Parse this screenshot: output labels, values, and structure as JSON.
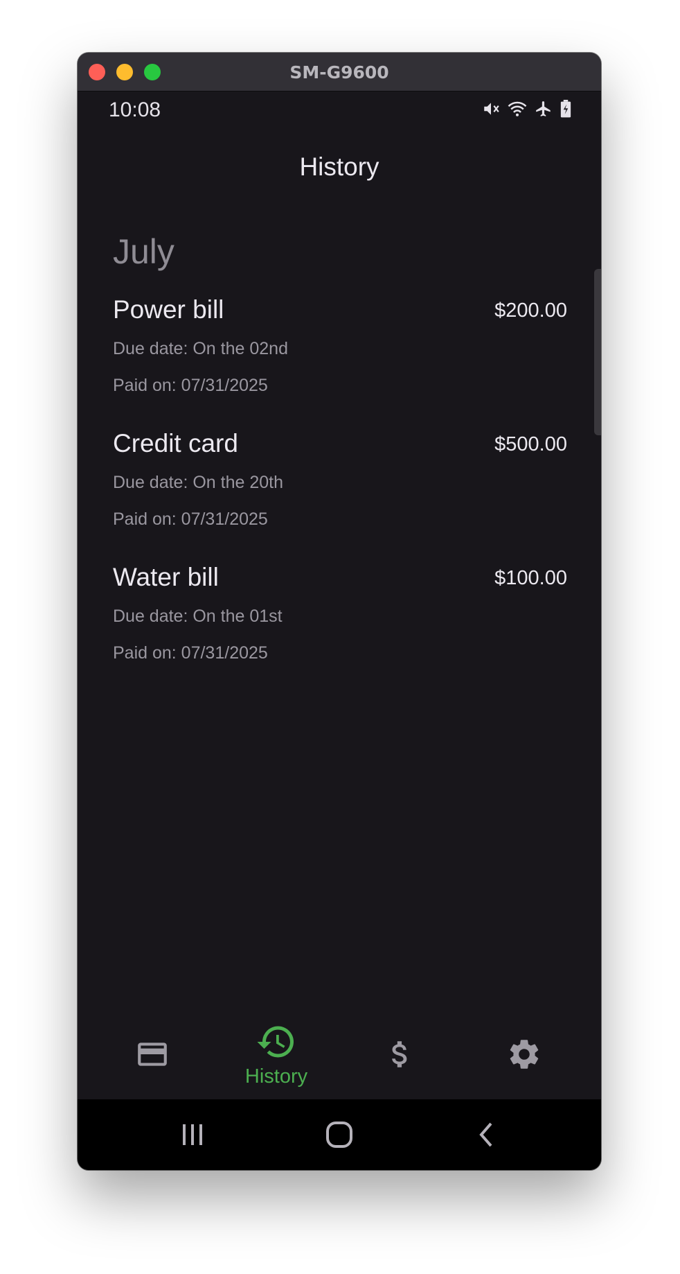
{
  "window": {
    "title": "SM-G9600"
  },
  "status": {
    "time": "10:08"
  },
  "appbar": {
    "title": "History"
  },
  "month": "July",
  "bills": [
    {
      "name": "Power bill",
      "amount": "$200.00",
      "due": "Due date: On the 02nd",
      "paid": "Paid on: 07/31/2025"
    },
    {
      "name": "Credit card",
      "amount": "$500.00",
      "due": "Due date: On the 20th",
      "paid": "Paid on: 07/31/2025"
    },
    {
      "name": "Water bill",
      "amount": "$100.00",
      "due": "Due date: On the 01st",
      "paid": "Paid on: 07/31/2025"
    }
  ],
  "nav": {
    "items": [
      {
        "icon": "credit-card-icon"
      },
      {
        "icon": "history-icon",
        "label": "History",
        "active": true
      },
      {
        "icon": "dollar-icon"
      },
      {
        "icon": "gear-icon"
      }
    ],
    "active_color": "#4caf50",
    "inactive_color": "#9e9ba3"
  }
}
